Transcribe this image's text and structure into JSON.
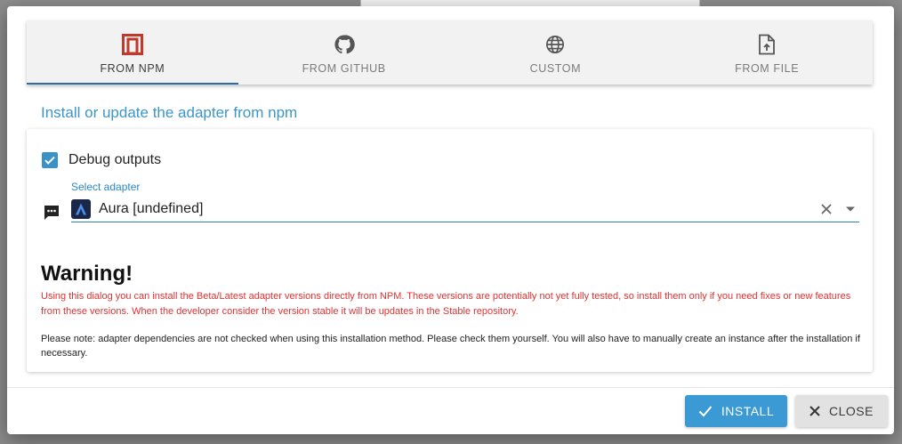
{
  "tabs": [
    {
      "label": "FROM NPM",
      "icon": "npm-icon",
      "active": true
    },
    {
      "label": "FROM GITHUB",
      "icon": "github-icon",
      "active": false
    },
    {
      "label": "CUSTOM",
      "icon": "globe-icon",
      "active": false
    },
    {
      "label": "FROM FILE",
      "icon": "file-upload-icon",
      "active": false
    }
  ],
  "heading": "Install or update the adapter from npm",
  "debug": {
    "label": "Debug outputs",
    "checked": true
  },
  "select": {
    "caption": "Select adapter",
    "value": "Aura [undefined]"
  },
  "warning": {
    "title": "Warning!",
    "text": "Using this dialog you can install the Beta/Latest adapter versions directly from NPM. These versions are potentially not yet fully tested, so install them only if you need fixes or new features from these versions. When the developer consider the version stable it will be updates in the Stable repository.",
    "note": "Please note: adapter dependencies are not checked when using this installation method. Please check them yourself. You will also have to manually create an instance after the installation if necessary."
  },
  "buttons": {
    "install": "INSTALL",
    "close": "CLOSE"
  },
  "colors": {
    "accent": "#3b9ad4",
    "heading": "#3b95c8",
    "warning": "#e03232",
    "npm": "#c0392b"
  }
}
